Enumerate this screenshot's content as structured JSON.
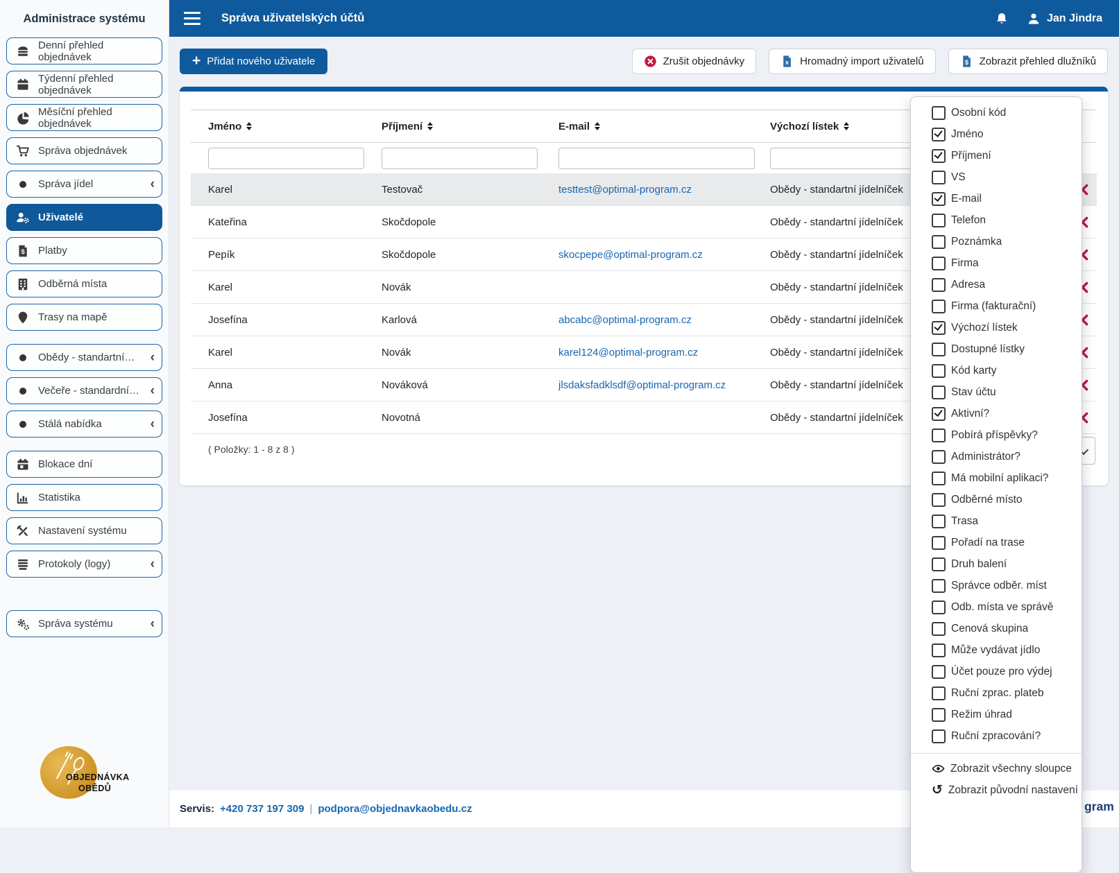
{
  "colors": {
    "primary": "#0f5a9d",
    "accent_red": "#c2183b",
    "link_blue": "#1766b0",
    "logo_gold": "#cf9426"
  },
  "sidebar": {
    "title": "Administrace systému",
    "items": [
      {
        "label": "Denní přehled objednávek",
        "icon": "burger-icon"
      },
      {
        "label": "Týdenní přehled objednávek",
        "icon": "calendar-icon"
      },
      {
        "label": "Měsíční přehled objednávek",
        "icon": "pie-chart-icon"
      },
      {
        "label": "Správa objednávek",
        "icon": "cart-icon"
      },
      {
        "label": "Správa jídel",
        "icon": "dot-icon",
        "chevron": true
      },
      {
        "label": "Uživatelé",
        "icon": "users-gear-icon",
        "active": true
      },
      {
        "label": "Platby",
        "icon": "invoice-dollar-icon"
      },
      {
        "label": "Odběrná místa",
        "icon": "building-icon"
      },
      {
        "label": "Trasy na mapě",
        "icon": "map-pin-icon"
      },
      {
        "label": "Obědy - standartní…",
        "icon": "dot-icon",
        "chevron": true
      },
      {
        "label": "Večeře - standardní…",
        "icon": "dot-icon",
        "chevron": true
      },
      {
        "label": "Stálá nabídka",
        "icon": "dot-icon",
        "chevron": true
      },
      {
        "label": "Blokace dní",
        "icon": "calendar-block-icon"
      },
      {
        "label": "Statistika",
        "icon": "stats-icon"
      },
      {
        "label": "Nastavení systému",
        "icon": "tools-icon"
      },
      {
        "label": "Protokoly (logy)",
        "icon": "logs-icon",
        "chevron": true
      },
      {
        "label": "Správa systému",
        "icon": "gears-icon",
        "chevron": true
      }
    ]
  },
  "topbar": {
    "title": "Správa uživatelských účtů",
    "user": "Jan Jindra"
  },
  "toolbar": {
    "add_user": "Přidat nového uživatele",
    "cancel_orders": "Zrušit objednávky",
    "bulk_import": "Hromadný import uživatelů",
    "debtors": "Zobrazit přehled dlužníků"
  },
  "table": {
    "columns": [
      "Jméno",
      "Příjmení",
      "E-mail",
      "Výchozí lístek"
    ],
    "rows": [
      {
        "first": "Karel",
        "last": "Testovač",
        "email": "testtest@optimal-program.cz",
        "menu": "Obědy - standartní jídelníček",
        "highlight": true
      },
      {
        "first": "Kateřina",
        "last": "Skočdopole",
        "email": "",
        "menu": "Obědy - standartní jídelníček"
      },
      {
        "first": "Pepík",
        "last": "Skočdopole",
        "email": "skocpepe@optimal-program.cz",
        "menu": "Obědy - standartní jídelníček"
      },
      {
        "first": "Karel",
        "last": "Novák",
        "email": "",
        "menu": "Obědy - standartní jídelníček"
      },
      {
        "first": "Josefína",
        "last": "Karlová",
        "email": "abcabc@optimal-program.cz",
        "menu": "Obědy - standartní jídelníček"
      },
      {
        "first": "Karel",
        "last": "Novák",
        "email": "karel124@optimal-program.cz",
        "menu": "Obědy - standartní jídelníček"
      },
      {
        "first": "Anna",
        "last": "Nováková",
        "email": "jlsdaksfadklsdf@optimal-program.cz",
        "menu": "Obědy - standartní jídelníček"
      },
      {
        "first": "Josefína",
        "last": "Novotná",
        "email": "",
        "menu": "Obědy - standartní jídelníček"
      }
    ],
    "items_info": "( Položky: 1 - 8 z 8 )"
  },
  "columns_panel": {
    "items": [
      {
        "label": "Osobní kód",
        "checked": false
      },
      {
        "label": "Jméno",
        "checked": true
      },
      {
        "label": "Příjmení",
        "checked": true
      },
      {
        "label": "VS",
        "checked": false
      },
      {
        "label": "E-mail",
        "checked": true
      },
      {
        "label": "Telefon",
        "checked": false
      },
      {
        "label": "Poznámka",
        "checked": false
      },
      {
        "label": "Firma",
        "checked": false
      },
      {
        "label": "Adresa",
        "checked": false
      },
      {
        "label": "Firma (fakturační)",
        "checked": false
      },
      {
        "label": "Výchozí lístek",
        "checked": true
      },
      {
        "label": "Dostupné lístky",
        "checked": false
      },
      {
        "label": "Kód karty",
        "checked": false
      },
      {
        "label": "Stav účtu",
        "checked": false
      },
      {
        "label": "Aktivní?",
        "checked": true
      },
      {
        "label": "Pobírá příspěvky?",
        "checked": false
      },
      {
        "label": "Administrátor?",
        "checked": false
      },
      {
        "label": "Má mobilní aplikaci?",
        "checked": false
      },
      {
        "label": "Odběrné místo",
        "checked": false
      },
      {
        "label": "Trasa",
        "checked": false
      },
      {
        "label": "Pořadí na trase",
        "checked": false
      },
      {
        "label": "Druh balení",
        "checked": false
      },
      {
        "label": "Správce odběr. míst",
        "checked": false
      },
      {
        "label": "Odb. místa ve správě",
        "checked": false
      },
      {
        "label": "Cenová skupina",
        "checked": false
      },
      {
        "label": "Může vydávat jídlo",
        "checked": false
      },
      {
        "label": "Účet pouze pro výdej",
        "checked": false
      },
      {
        "label": "Ruční zprac. plateb",
        "checked": false
      },
      {
        "label": "Režim úhrad",
        "checked": false
      },
      {
        "label": "Ruční zpracování?",
        "checked": false
      }
    ],
    "show_all": "Zobrazit všechny sloupce",
    "reset": "Zobrazit původní nastavení"
  },
  "footer": {
    "servis_label": "Servis:",
    "phone": "+420 737 197 309",
    "separator": "|",
    "email": "podpora@objednavkaobedu.cz",
    "brand_fragment": "gram"
  },
  "logo": {
    "line1": "OBJEDNÁVKA",
    "line2": "OBĚDŮ"
  }
}
